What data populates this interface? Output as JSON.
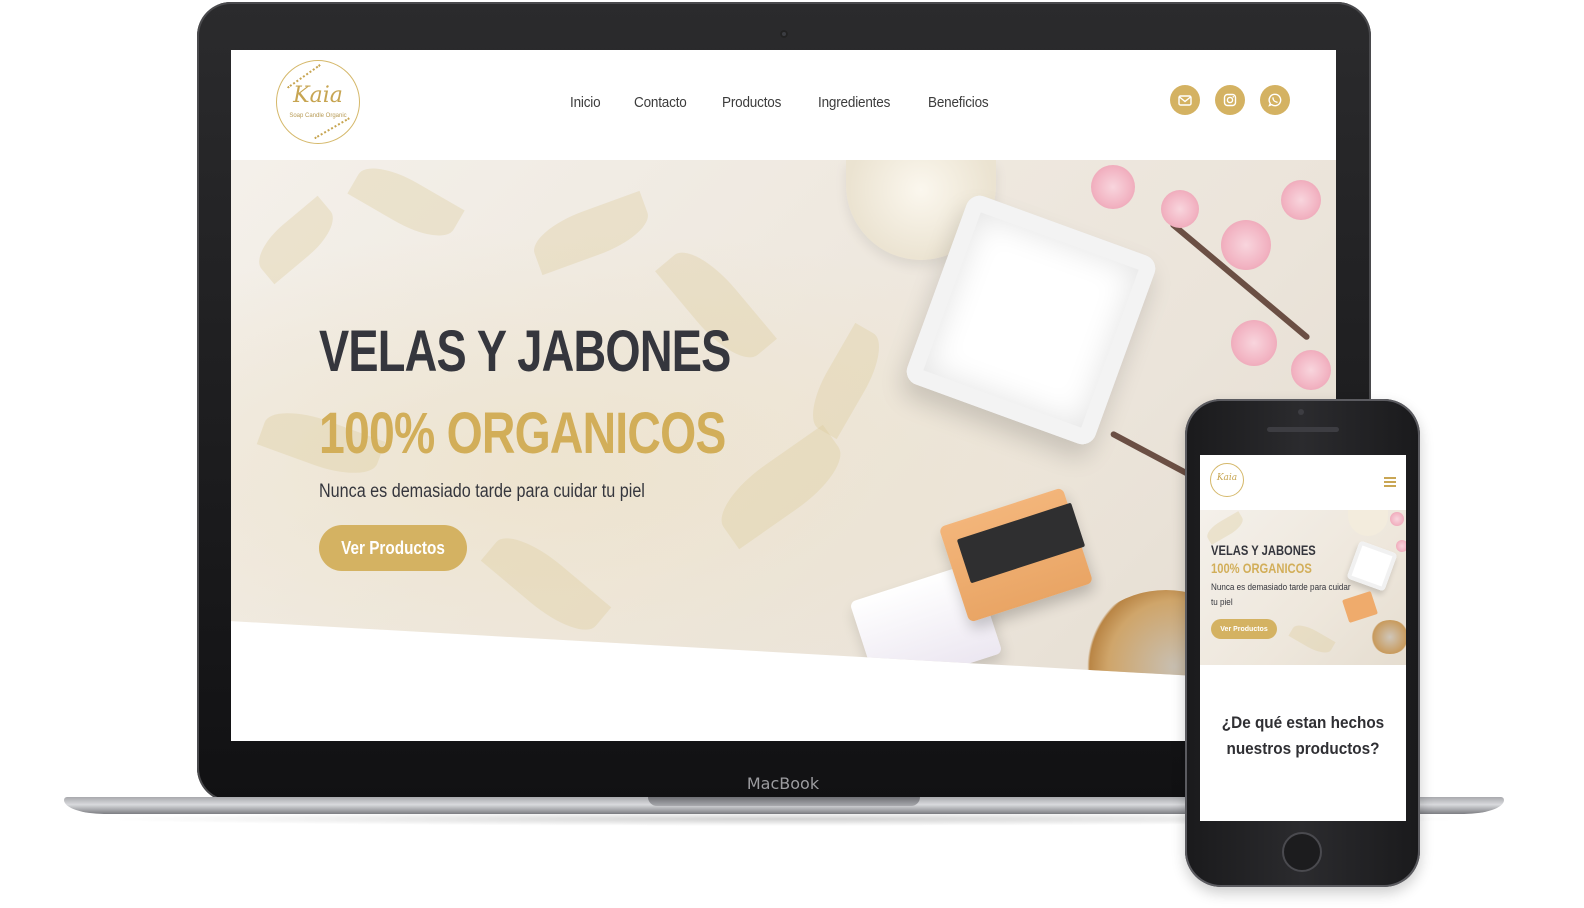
{
  "brand": {
    "logo_name": "Kaia",
    "logo_tagline": "Soap Candle Organic",
    "device_label": "MacBook"
  },
  "nav": {
    "items": [
      {
        "label": "Inicio"
      },
      {
        "label": "Contacto"
      },
      {
        "label": "Productos"
      },
      {
        "label": "Ingredientes"
      },
      {
        "label": "Beneficios"
      }
    ]
  },
  "social": [
    {
      "icon": "mail-icon"
    },
    {
      "icon": "instagram-icon"
    },
    {
      "icon": "whatsapp-icon"
    }
  ],
  "hero": {
    "title": "VELAS Y JABONES",
    "subtitle": "100% ORGANICOS",
    "text": "Nunca es demasiado tarde para cuidar tu piel",
    "cta": "Ver Productos"
  },
  "mobile": {
    "section_title_line1": "¿De qué estan hechos",
    "section_title_line2": "nuestros productos?"
  },
  "colors": {
    "accent": "#d4b262",
    "dark_text": "#35363d"
  }
}
